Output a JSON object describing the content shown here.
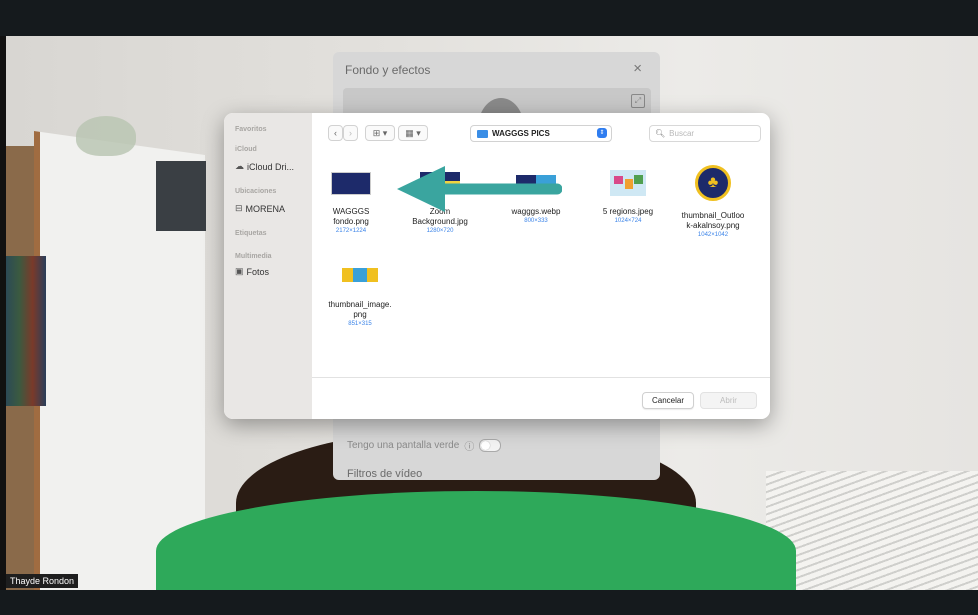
{
  "video": {
    "participant_name": "Thayde Rondon"
  },
  "zoom_panel": {
    "title": "Fondo y efectos",
    "close_label": "×",
    "green_screen_label": "Tengo una pantalla verde",
    "filters_label": "Filtros de vídeo"
  },
  "dialog": {
    "sidebar": {
      "sections": [
        {
          "header": "Favoritos",
          "items": []
        },
        {
          "header": "iCloud",
          "items": [
            {
              "label": "iCloud Dri...",
              "icon": "cloud-icon"
            }
          ]
        },
        {
          "header": "Ubicaciones",
          "items": [
            {
              "label": "MORENA",
              "icon": "drive-icon"
            }
          ]
        },
        {
          "header": "Etiquetas",
          "items": []
        },
        {
          "header": "Multimedia",
          "items": [
            {
              "label": "Fotos",
              "icon": "photos-icon"
            }
          ]
        }
      ]
    },
    "toolbar": {
      "back": "‹",
      "forward": "›",
      "view_grid": "⊞ ▾",
      "view_group": "▦ ▾",
      "folder": "WAGGGS PICS",
      "search_placeholder": "Buscar"
    },
    "files": [
      {
        "name1": "WAGGGS",
        "name2": "fondo.png",
        "dims": "2172×1224"
      },
      {
        "name1": "Zoom",
        "name2": "Background.jpg",
        "dims": "1280×720"
      },
      {
        "name1": "wagggs.webp",
        "name2": "",
        "dims": "800×333"
      },
      {
        "name1": "5 regions.jpeg",
        "name2": "",
        "dims": "1024×724"
      },
      {
        "name1": "thumbnail_Outloo",
        "name2": "k-akalnsoy.png",
        "dims": "1042×1042"
      },
      {
        "name1": "thumbnail_image.",
        "name2": "png",
        "dims": "851×315"
      }
    ],
    "buttons": {
      "cancel": "Cancelar",
      "open": "Abrir"
    }
  },
  "colors": {
    "arrow": "#3aa59f",
    "accent": "#2f7df0",
    "sweater": "#2ea95a"
  }
}
